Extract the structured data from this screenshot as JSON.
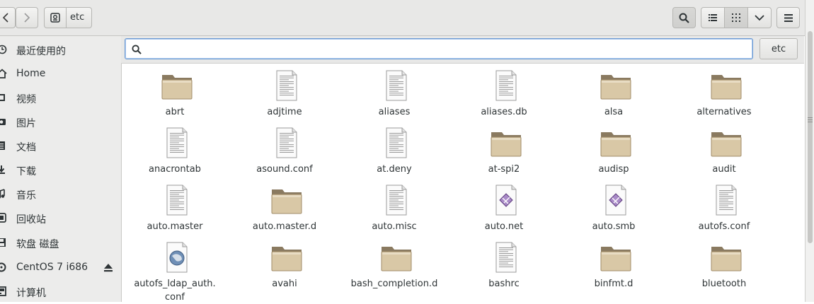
{
  "toolbar": {
    "back_icon": "chevron-left-icon",
    "forward_icon": "chevron-right-icon",
    "location_label": "etc",
    "search_icon": "search-icon",
    "list_view_icon": "list-icon",
    "grid_view_icon": "grid-icon",
    "view_menu_icon": "chevron-down-icon",
    "menu_icon": "hamburger-icon"
  },
  "sidebar": {
    "items": [
      {
        "label": "最近使用的",
        "icon": "clock-icon"
      },
      {
        "label": "Home",
        "icon": "home-icon"
      },
      {
        "label": "视频",
        "icon": "video-icon"
      },
      {
        "label": "图片",
        "icon": "camera-icon"
      },
      {
        "label": "文档",
        "icon": "document-icon"
      },
      {
        "label": "下载",
        "icon": "download-icon"
      },
      {
        "label": "音乐",
        "icon": "music-icon"
      },
      {
        "label": "回收站",
        "icon": "trash-icon"
      },
      {
        "label": "软盘 磁盘",
        "icon": "floppy-icon"
      },
      {
        "label": "CentOS 7 i686",
        "icon": "disc-icon"
      },
      {
        "label": "计算机",
        "icon": "computer-icon"
      }
    ],
    "eject_icon": "eject-icon"
  },
  "search": {
    "placeholder": "",
    "value": "",
    "location_crumb": "etc"
  },
  "files": [
    {
      "name": "abrt",
      "type": "folder"
    },
    {
      "name": "adjtime",
      "type": "text"
    },
    {
      "name": "aliases",
      "type": "text"
    },
    {
      "name": "aliases.db",
      "type": "text"
    },
    {
      "name": "alsa",
      "type": "folder"
    },
    {
      "name": "alternatives",
      "type": "folder"
    },
    {
      "name": "anacrontab",
      "type": "text"
    },
    {
      "name": "asound.conf",
      "type": "text"
    },
    {
      "name": "at.deny",
      "type": "text"
    },
    {
      "name": "at-spi2",
      "type": "folder"
    },
    {
      "name": "audisp",
      "type": "folder"
    },
    {
      "name": "audit",
      "type": "folder"
    },
    {
      "name": "auto.master",
      "type": "text"
    },
    {
      "name": "auto.master.d",
      "type": "folder"
    },
    {
      "name": "auto.misc",
      "type": "text"
    },
    {
      "name": "auto.net",
      "type": "script"
    },
    {
      "name": "auto.smb",
      "type": "script"
    },
    {
      "name": "autofs.conf",
      "type": "text"
    },
    {
      "name": "autofs_ldap_auth.\nconf",
      "type": "web"
    },
    {
      "name": "avahi",
      "type": "folder"
    },
    {
      "name": "bash_completion.d",
      "type": "folder"
    },
    {
      "name": "bashrc",
      "type": "text"
    },
    {
      "name": "binfmt.d",
      "type": "folder"
    },
    {
      "name": "bluetooth",
      "type": "folder"
    }
  ],
  "colors": {
    "folder": "#d9c8a6",
    "folder_dark": "#8a7a60",
    "accent": "#6d9bd3"
  }
}
